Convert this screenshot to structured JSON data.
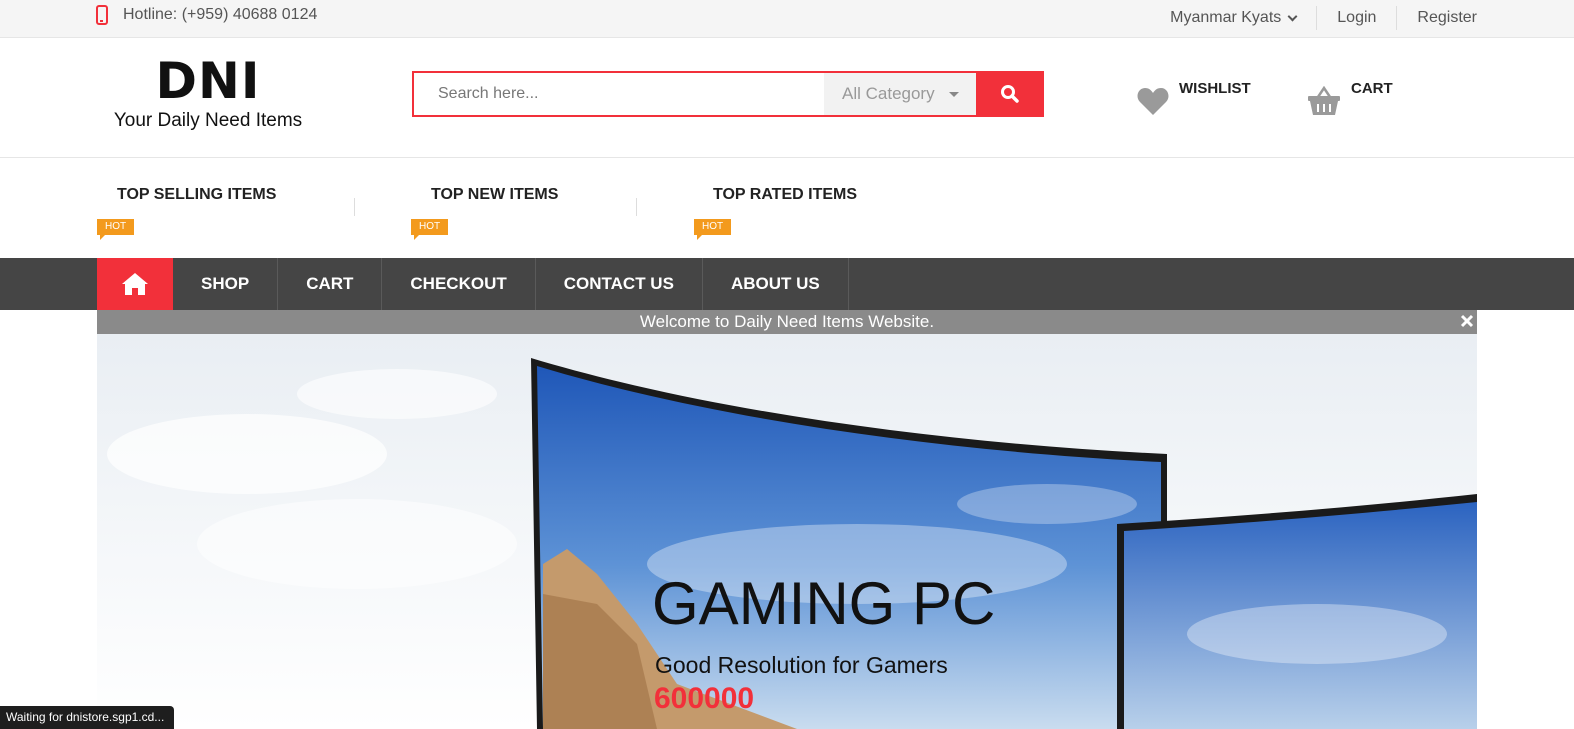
{
  "topbar": {
    "hotline": "Hotline: (+959) 40688 0124",
    "currency": "Myanmar Kyats",
    "login": "Login",
    "register": "Register"
  },
  "header": {
    "logo_mark": "DNI",
    "logo_tagline": "Your Daily Need Items",
    "search_placeholder": "Search here...",
    "category": "All Category",
    "wishlist_label": "WISHLIST",
    "cart_label": "CART"
  },
  "tabs": [
    {
      "label": "TOP SELLING ITEMS",
      "badge": "HOT"
    },
    {
      "label": "TOP NEW ITEMS",
      "badge": "HOT"
    },
    {
      "label": "TOP RATED ITEMS",
      "badge": "HOT"
    }
  ],
  "nav": {
    "items": [
      {
        "label": "SHOP"
      },
      {
        "label": "CART"
      },
      {
        "label": "CHECKOUT"
      },
      {
        "label": "CONTACT US"
      },
      {
        "label": "ABOUT US"
      }
    ]
  },
  "notice": "Welcome to Daily Need Items Website.",
  "hero": {
    "title": "GAMING PC",
    "subtitle": "Good Resolution for Gamers",
    "price": "600000"
  },
  "statusbar": "Waiting for dnistore.sgp1.cd...",
  "colors": {
    "accent": "#f2303a",
    "badge": "#f39a1d",
    "nav_bg": "#454545"
  }
}
